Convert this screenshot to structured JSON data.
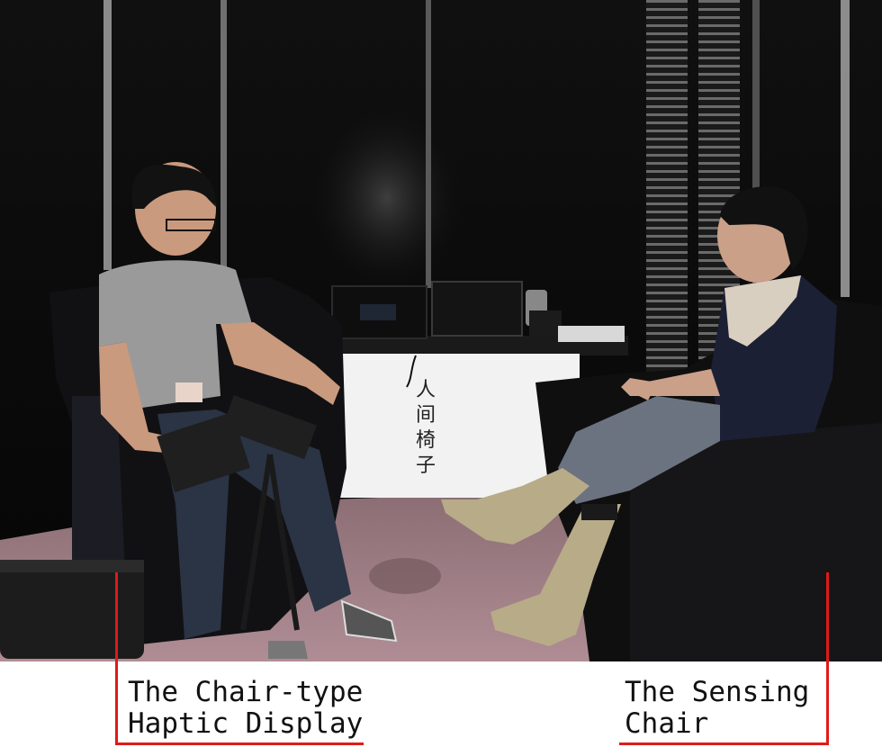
{
  "photo": {
    "banner_text": [
      "人",
      "间",
      "椅",
      "子"
    ]
  },
  "captions": {
    "left": {
      "line1": "The Chair-type",
      "line2": "Haptic Display"
    },
    "right": {
      "line1": "The Sensing",
      "line2": "Chair"
    },
    "bracket_color": "#e01a1a"
  }
}
